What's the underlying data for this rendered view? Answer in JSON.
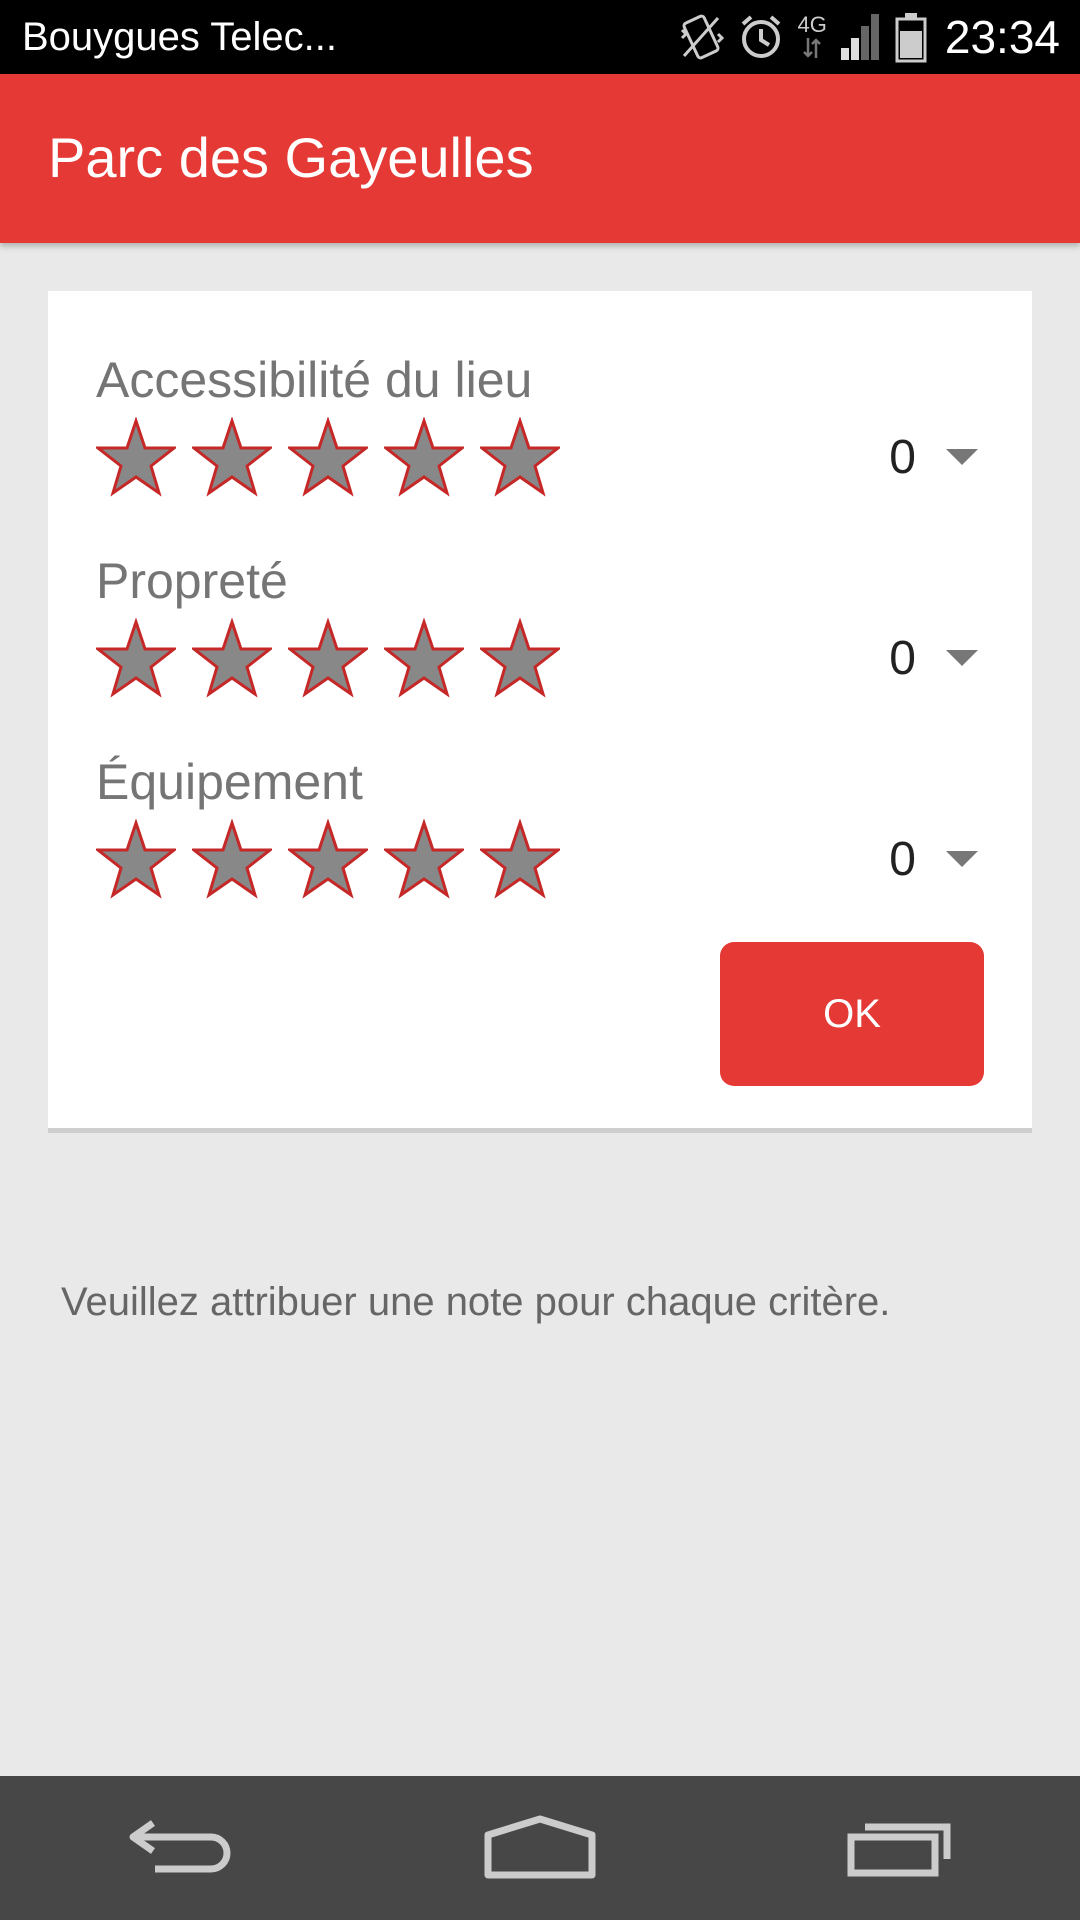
{
  "statusbar": {
    "carrier": "Bouygues Telec...",
    "network": "4G",
    "time": "23:34",
    "icons": [
      "vibrate-icon",
      "alarm-icon",
      "network-4g-icon",
      "signal-icon",
      "battery-icon"
    ]
  },
  "appbar": {
    "title": "Parc des Gayeulles"
  },
  "criteria": [
    {
      "label": "Accessibilité du lieu",
      "rating": 0,
      "max": 5,
      "value": "0"
    },
    {
      "label": "Propreté",
      "rating": 0,
      "max": 5,
      "value": "0"
    },
    {
      "label": "Équipement",
      "rating": 0,
      "max": 5,
      "value": "0"
    }
  ],
  "ok_button": {
    "label": "OK"
  },
  "hint": "Veuillez attribuer une note pour chaque critère.",
  "colors": {
    "accent": "#e53935",
    "star_fill": "#888888",
    "star_stroke": "#c62828",
    "background": "#e9e9e9",
    "navbar": "#474747"
  },
  "navbar": {
    "icons": [
      "back-icon",
      "home-icon",
      "recents-icon"
    ]
  }
}
